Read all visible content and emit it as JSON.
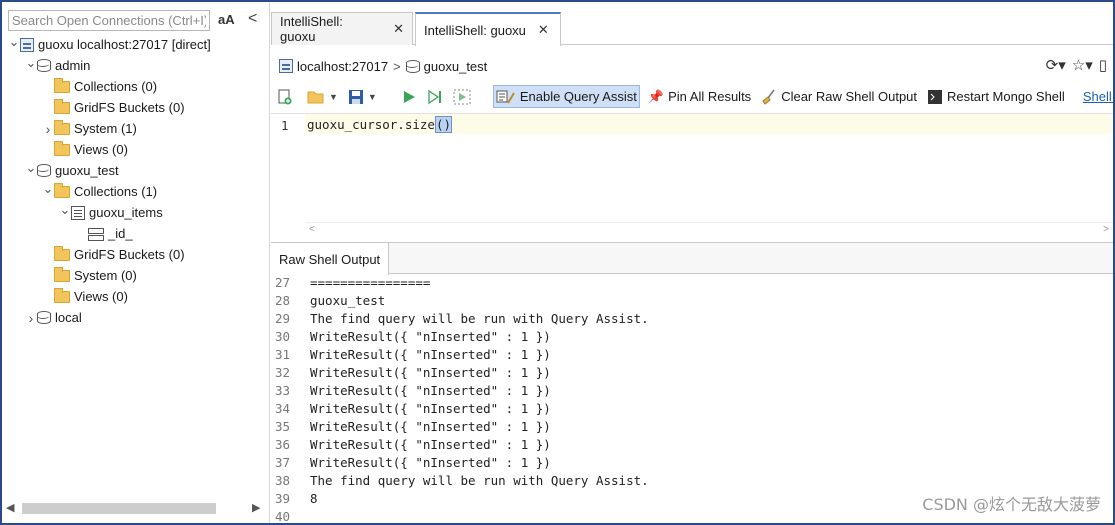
{
  "left": {
    "search_placeholder": "Search Open Connections (Ctrl+I)",
    "case_toggle": "aA",
    "collapse": "<",
    "tree": [
      {
        "label": "guoxu localhost:27017 [direct]",
        "icon": "server-icon",
        "level": 0,
        "expand": "open"
      },
      {
        "label": "admin",
        "icon": "database-icon",
        "level": 1,
        "expand": "open"
      },
      {
        "label": "Collections (0)",
        "icon": "folder-icon",
        "level": 2,
        "expand": "none"
      },
      {
        "label": "GridFS Buckets (0)",
        "icon": "folder-icon",
        "level": 2,
        "expand": "none"
      },
      {
        "label": "System (1)",
        "icon": "folder-icon",
        "level": 2,
        "expand": "closed"
      },
      {
        "label": "Views (0)",
        "icon": "folder-icon",
        "level": 2,
        "expand": "none"
      },
      {
        "label": "guoxu_test",
        "icon": "database-icon",
        "level": 1,
        "expand": "open"
      },
      {
        "label": "Collections (1)",
        "icon": "folder-icon",
        "level": 2,
        "expand": "open"
      },
      {
        "label": "guoxu_items",
        "icon": "collection-icon",
        "level": 3,
        "expand": "open"
      },
      {
        "label": "_id_",
        "icon": "index-icon",
        "level": 4,
        "expand": "none"
      },
      {
        "label": "GridFS Buckets (0)",
        "icon": "folder-icon",
        "level": 2,
        "expand": "none"
      },
      {
        "label": "System (0)",
        "icon": "folder-icon",
        "level": 2,
        "expand": "none"
      },
      {
        "label": "Views (0)",
        "icon": "folder-icon",
        "level": 2,
        "expand": "none"
      },
      {
        "label": "local",
        "icon": "database-icon",
        "level": 1,
        "expand": "closed"
      }
    ]
  },
  "tabs": [
    {
      "label": "IntelliShell: guoxu",
      "close": "✕"
    },
    {
      "label": "IntelliShell: guoxu",
      "close": "✕"
    }
  ],
  "breadcrumb": {
    "host": "localhost:27017",
    "sep": ">",
    "db": "guoxu_test"
  },
  "toolbar": {
    "enable_query_assist": "Enable Query Assist",
    "pin_all_results": "Pin All Results",
    "clear_raw_shell_output": "Clear Raw Shell Output",
    "restart_mongo_shell": "Restart Mongo Shell",
    "shell_menu": "Shell M"
  },
  "editor": {
    "line_number": "1",
    "code_before": "guoxu_cursor.size",
    "code_selected": "()"
  },
  "output": {
    "tab": "Raw Shell Output",
    "lines": [
      {
        "n": "27",
        "t": "================"
      },
      {
        "n": "28",
        "t": "guoxu_test"
      },
      {
        "n": "29",
        "t": "The find query will be run with Query Assist."
      },
      {
        "n": "30",
        "t": "WriteResult({ \"nInserted\" : 1 })"
      },
      {
        "n": "31",
        "t": "WriteResult({ \"nInserted\" : 1 })"
      },
      {
        "n": "32",
        "t": "WriteResult({ \"nInserted\" : 1 })"
      },
      {
        "n": "33",
        "t": "WriteResult({ \"nInserted\" : 1 })"
      },
      {
        "n": "34",
        "t": "WriteResult({ \"nInserted\" : 1 })"
      },
      {
        "n": "35",
        "t": "WriteResult({ \"nInserted\" : 1 })"
      },
      {
        "n": "36",
        "t": "WriteResult({ \"nInserted\" : 1 })"
      },
      {
        "n": "37",
        "t": "WriteResult({ \"nInserted\" : 1 })"
      },
      {
        "n": "38",
        "t": "The find query will be run with Query Assist."
      },
      {
        "n": "39",
        "t": "8"
      },
      {
        "n": "40",
        "t": ""
      }
    ]
  },
  "watermark": "CSDN @炫个无敌大菠萝",
  "colors": {
    "accent": "#4a7bc8",
    "frame": "#2b4a8a",
    "run": "#3aa55a"
  }
}
